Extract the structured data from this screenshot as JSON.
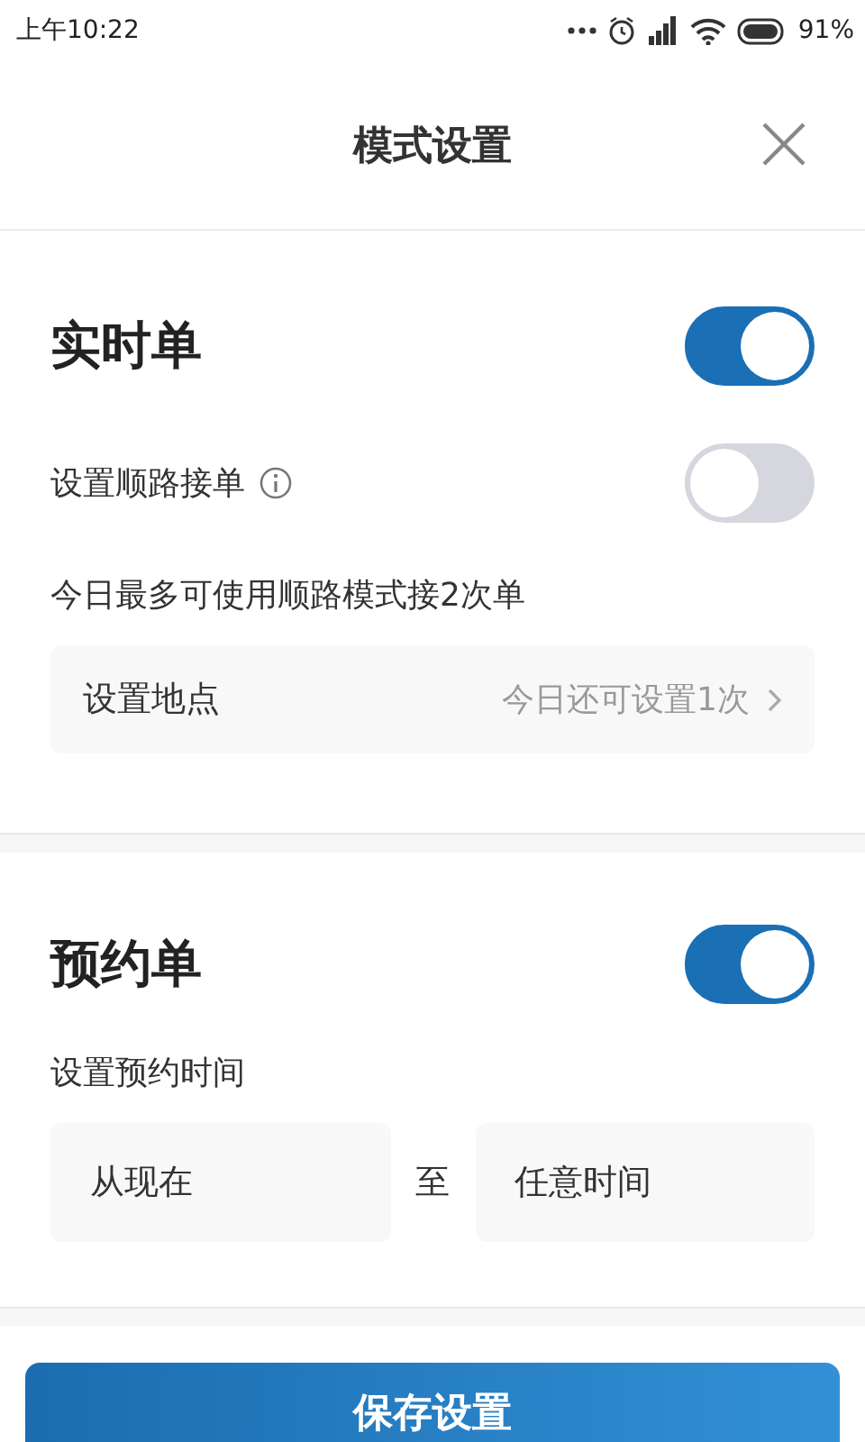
{
  "status_bar": {
    "time": "上午10:22",
    "battery": "91%"
  },
  "header": {
    "title": "模式设置"
  },
  "realtime": {
    "title": "实时单",
    "on": true,
    "route_toggle": {
      "label": "设置顺路接单",
      "on": false
    },
    "note": "今日最多可使用顺路模式接2次单",
    "location_row": {
      "label": "设置地点",
      "value": "今日还可设置1次"
    }
  },
  "reservation": {
    "title": "预约单",
    "on": true,
    "time_label": "设置预约时间",
    "from_value": "从现在",
    "separator": "至",
    "to_value": "任意时间"
  },
  "save_button": "保存设置"
}
